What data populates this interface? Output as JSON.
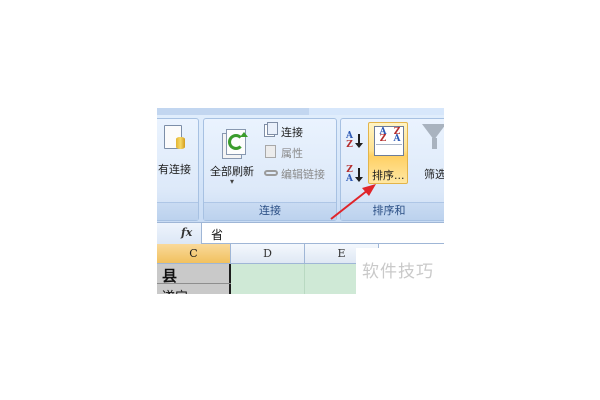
{
  "ribbon": {
    "left_group": {
      "button_label": "有连接"
    },
    "connections_group": {
      "refresh_all_label": "全部刷新",
      "connections_label": "连接",
      "properties_label": "属性",
      "edit_links_label": "编辑链接",
      "group_label": "连接"
    },
    "sort_filter_group": {
      "sort_label": "排序...",
      "filter_label": "筛选",
      "group_label": "排序和"
    }
  },
  "formula_bar": {
    "fx_label": "fx",
    "content": "省"
  },
  "grid": {
    "columns": [
      "C",
      "D",
      "E"
    ],
    "selected_column": "C",
    "cells": {
      "c_row1": "县",
      "c_row2": "遂宁"
    }
  },
  "watermark": "软件技巧",
  "colors": {
    "annotation_arrow": "#e0242a",
    "sort_highlight": "#ffd064",
    "selected_column": "#f1c15f",
    "green_cells": "#cfe9d6"
  }
}
